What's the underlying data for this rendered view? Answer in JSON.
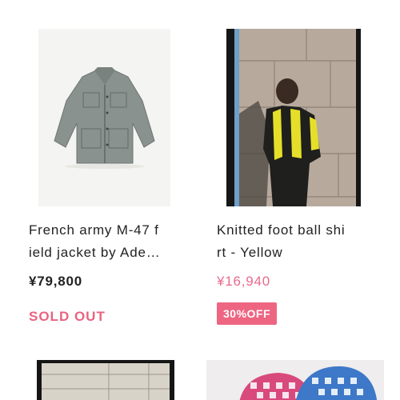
{
  "products": [
    {
      "title_lines": [
        "French army M-47 f",
        "ield jacket by Ade…"
      ],
      "price": "¥79,800",
      "status": "SOLD OUT"
    },
    {
      "title_lines": [
        "Knitted foot ball shi",
        "rt - Yellow"
      ],
      "price": "¥16,940",
      "badge": "30%OFF"
    }
  ],
  "colors": {
    "sale_price": "#e96a8d",
    "sold_out": "#e9637f",
    "badge_bg": "#ee6582"
  }
}
